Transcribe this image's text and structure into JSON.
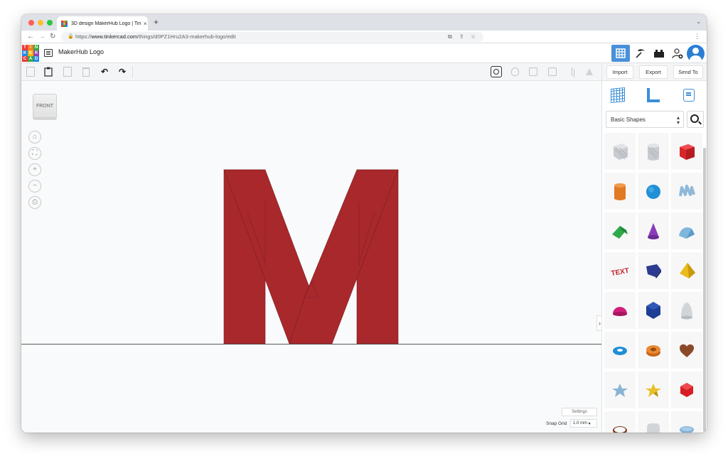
{
  "browser": {
    "tab_title": "3D design MakerHub Logo | Tinkercad",
    "url_prefix": "https://",
    "url_host": "www.tinkercad.com",
    "url_path": "/things/d0PZ1Hru2A3-makerhub-logo/edit",
    "new_tab": "+",
    "tab_close": "×"
  },
  "app": {
    "logo_letters": [
      "T",
      "I",
      "N",
      "K",
      "E",
      "R",
      "C",
      "A",
      "D"
    ],
    "logo_colors": [
      "#e83a3a",
      "#f47c20",
      "#3aa63f",
      "#1e88e5",
      "#f4b400",
      "#8e44ad",
      "#e83a3a",
      "#3aa63f",
      "#1e88e5"
    ],
    "design_title": "MakerHub Logo"
  },
  "actions": {
    "import": "Import",
    "export": "Export",
    "send_to": "Send To"
  },
  "viewcube": {
    "label": "FRONT"
  },
  "view_controls": [
    "⌂",
    "⛶",
    "+",
    "−",
    "⎙"
  ],
  "workplane": {
    "settings_label": "Settings",
    "snap_grid_label": "Snap Grid",
    "snap_grid_value": "1.0 mm",
    "model_color": "#a8282c"
  },
  "panel": {
    "library": "Basic Shapes",
    "shapes": [
      "box-hole-shape",
      "cylinder-hole-shape",
      "box-shape",
      "cylinder-shape",
      "sphere-shape",
      "scribble-shape",
      "roof-shape",
      "cone-shape",
      "round-roof-shape",
      "text-shape",
      "polygon-shape",
      "pyramid-shape",
      "half-sphere-shape",
      "icosahedron-shape",
      "paraboloid-shape",
      "torus-shape",
      "tube-shape",
      "heart-shape",
      "star-hole-shape",
      "star-shape",
      "gem-shape",
      "ring-shape",
      "round-box-shape",
      "hemisphere-hole-shape"
    ]
  },
  "colors": {
    "accent": "#4a90d9",
    "model_red": "#a8282c"
  }
}
